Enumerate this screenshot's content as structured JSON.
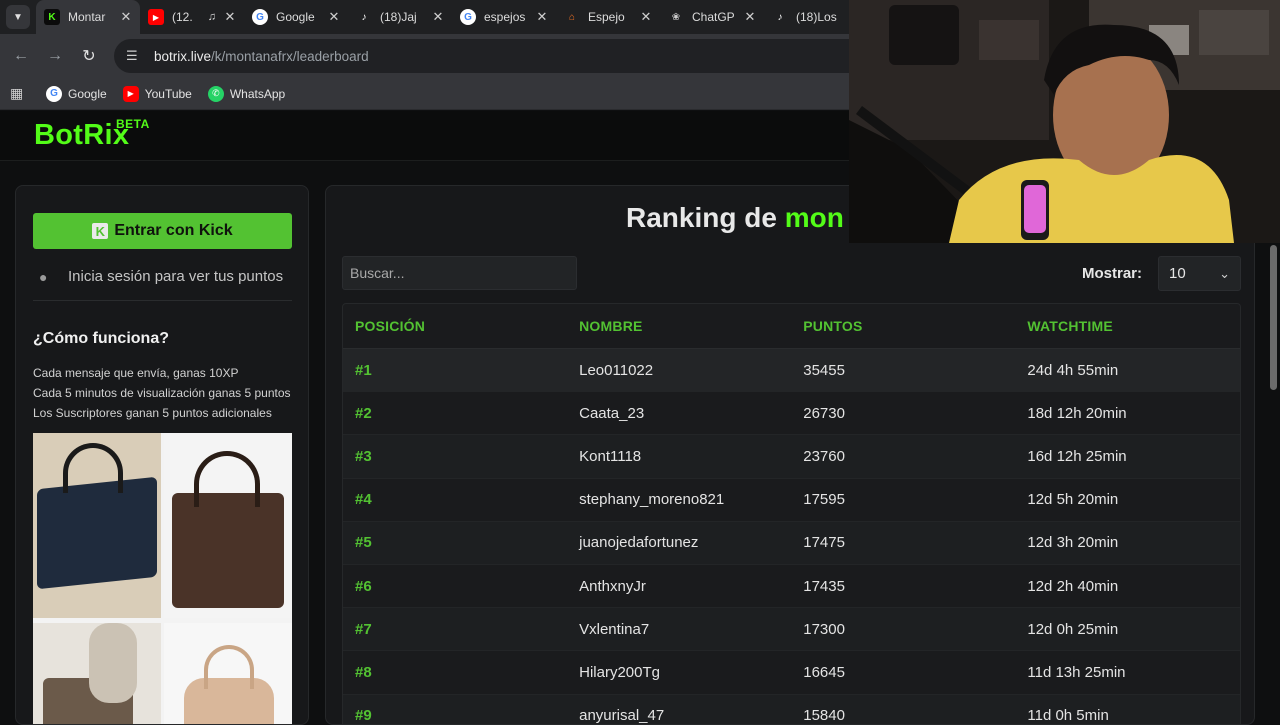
{
  "browser": {
    "tabs": [
      {
        "title": "Montar",
        "favicon": "kick-icon",
        "color": "#53fc18"
      },
      {
        "title": "(12.",
        "favicon": "youtube-icon",
        "color": "#ff0000"
      },
      {
        "title": "Google",
        "favicon": "google-icon",
        "color": "#4285f4"
      },
      {
        "title": "(18)Jaj",
        "favicon": "tiktok-icon",
        "color": "#ffffff"
      },
      {
        "title": "espejos",
        "favicon": "google-icon",
        "color": "#4285f4"
      },
      {
        "title": "Espejo",
        "favicon": "store-icon",
        "color": "#f57224"
      },
      {
        "title": "ChatGP",
        "favicon": "chatgpt-icon",
        "color": "#cfcfcf"
      },
      {
        "title": "(18)Los",
        "favicon": "tiktok-icon",
        "color": "#ffffff"
      }
    ],
    "url_host": "botrix.live",
    "url_path": "/k/montanafrx/leaderboard",
    "bookmarks": [
      {
        "label": "Google",
        "icon": "google-icon"
      },
      {
        "label": "YouTube",
        "icon": "youtube-icon"
      },
      {
        "label": "WhatsApp",
        "icon": "whatsapp-icon"
      }
    ]
  },
  "site": {
    "logo": "BotRix",
    "logo_badge": "BETA",
    "accent": "#53fc18"
  },
  "sidebar": {
    "kick_button": "Entrar con Kick",
    "login_hint": "Inicia sesión para ver tus puntos",
    "how_title": "¿Cómo funciona?",
    "how_lines": [
      "Cada mensaje que envía, ganas 10XP",
      "Cada 5 minutos de visualización ganas 5 puntos",
      "Los Suscriptores ganan 5 puntos adicionales"
    ]
  },
  "main": {
    "title_prefix": "Ranking de",
    "title_channel": "mon",
    "search_placeholder": "Buscar...",
    "show_label": "Mostrar:",
    "show_value": "10",
    "columns": [
      "POSICIÓN",
      "NOMBRE",
      "PUNTOS",
      "WATCHTIME"
    ],
    "rows": [
      {
        "pos": "#1",
        "name": "Leo011022",
        "points": "35455",
        "watch": "24d 4h 55min"
      },
      {
        "pos": "#2",
        "name": "Caata_23",
        "points": "26730",
        "watch": "18d 12h 20min"
      },
      {
        "pos": "#3",
        "name": "Kont1118",
        "points": "23760",
        "watch": "16d 12h 25min"
      },
      {
        "pos": "#4",
        "name": "stephany_moreno821",
        "points": "17595",
        "watch": "12d 5h 20min"
      },
      {
        "pos": "#5",
        "name": "juanojedafortunez",
        "points": "17475",
        "watch": "12d 3h 20min"
      },
      {
        "pos": "#6",
        "name": "AnthxnyJr",
        "points": "17435",
        "watch": "12d 2h 40min"
      },
      {
        "pos": "#7",
        "name": "Vxlentina7",
        "points": "17300",
        "watch": "12d 0h 25min"
      },
      {
        "pos": "#8",
        "name": "Hilary200Tg",
        "points": "16645",
        "watch": "11d 13h 25min"
      },
      {
        "pos": "#9",
        "name": "anyurisal_47",
        "points": "15840",
        "watch": "11d 0h 5min"
      }
    ]
  }
}
